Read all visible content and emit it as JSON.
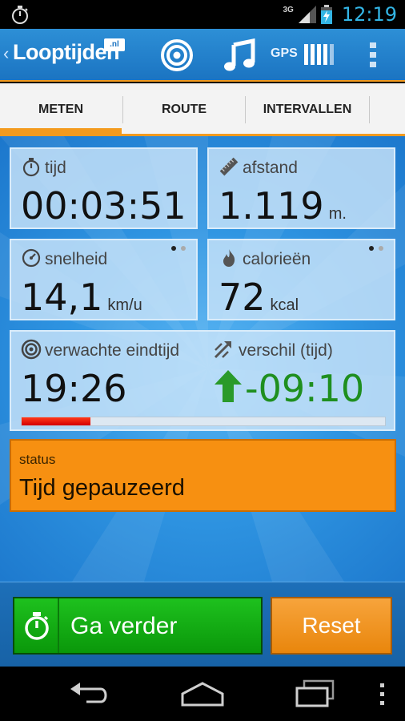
{
  "status_bar": {
    "network": "3G",
    "time": "12:19",
    "left_icon": "stopwatch-icon",
    "time_color": "#33b5e5"
  },
  "action_bar": {
    "logo_text": "Looptijden",
    "logo_badge": ".nl",
    "gps_label": "GPS",
    "icons": [
      "target-icon",
      "music-icon",
      "gps-signal-icon",
      "overflow-menu-icon"
    ]
  },
  "tabs": [
    {
      "label": "METEN",
      "selected": true
    },
    {
      "label": "ROUTE",
      "selected": false
    },
    {
      "label": "INTERVALLEN",
      "selected": false
    }
  ],
  "panels": {
    "tijd": {
      "label": "tijd",
      "value": "00:03:51",
      "icon": "stopwatch-icon"
    },
    "afstand": {
      "label": "afstand",
      "value": "1.119",
      "unit": "m.",
      "icon": "ruler-icon"
    },
    "snelheid": {
      "label": "snelheid",
      "value": "14,1",
      "unit": "km/u",
      "icon": "speedometer-icon"
    },
    "calorieen": {
      "label": "calorieën",
      "value": "72",
      "unit": "kcal",
      "icon": "flame-icon"
    },
    "eindtijd": {
      "label": "verwachte eindtijd",
      "value": "19:26",
      "icon": "target-icon"
    },
    "verschil": {
      "label": "verschil (tijd)",
      "value": "-09:10",
      "icon": "trend-arrow-icon",
      "value_color": "#1f8f1f"
    }
  },
  "progress": {
    "fraction": 0.19,
    "color": "#e00000"
  },
  "status": {
    "label": "status",
    "value": "Tijd gepauzeerd",
    "color": "#f79011"
  },
  "buttons": {
    "continue_label": "Ga verder",
    "reset_label": "Reset"
  },
  "colors": {
    "accent": "#f39a1e",
    "action_bar": "#1b74c2",
    "go_button": "#13ac13"
  }
}
